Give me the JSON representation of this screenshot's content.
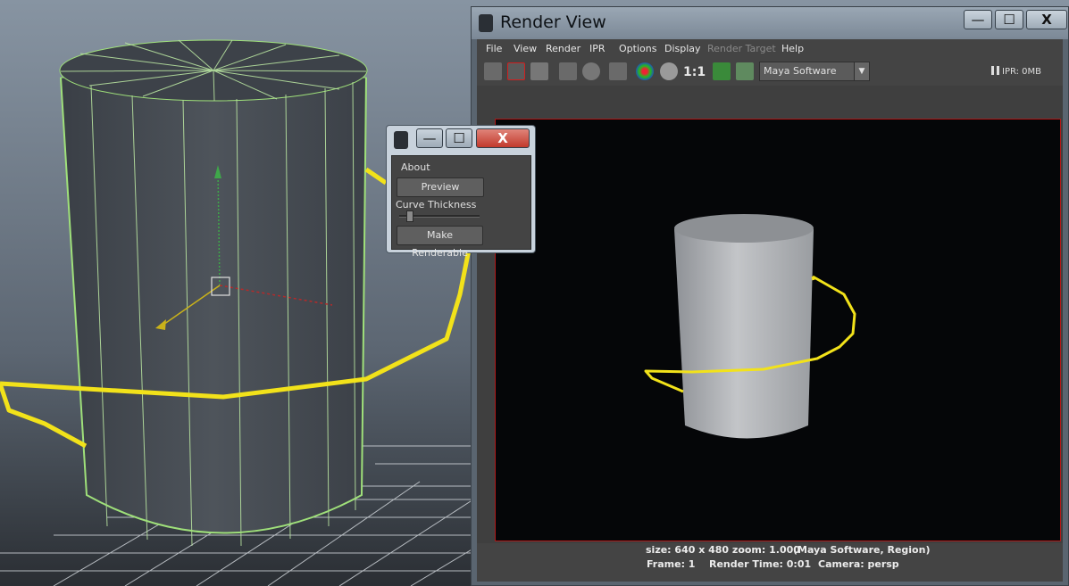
{
  "render_view": {
    "title": "Render View",
    "window_buttons": {
      "minimize": "—",
      "maximize": "☐",
      "close": "X"
    },
    "menu": [
      "File",
      "View",
      "Render",
      "IPR",
      "Options",
      "Display",
      "Render Target",
      "Help"
    ],
    "menu_disabled": [
      "Render Target"
    ],
    "toolbar": {
      "ratio_label": "1:1",
      "renderer": "Maya Software",
      "ipr_memory": "IPR: 0MB"
    },
    "status": {
      "line1_left": "size: 640 x 480 zoom: 1.000",
      "line1_right": "(Maya Software, Region)",
      "frame": "Frame: 1",
      "render_time": "Render Time: 0:01",
      "camera": "Camera: persp"
    }
  },
  "dialog": {
    "window_buttons": {
      "minimize": "—",
      "maximize": "☐",
      "close": "X"
    },
    "about": "About",
    "preview_button": "Preview",
    "curve_thickness_label": "Curve Thickness",
    "curve_thickness_value": 0.1,
    "make_renderable_button": "Make Renderable"
  },
  "colors": {
    "curve": "#f2e21a",
    "viewport_bg": "#6b7684",
    "render_bg": "#050608",
    "region_border": "#b01818"
  }
}
